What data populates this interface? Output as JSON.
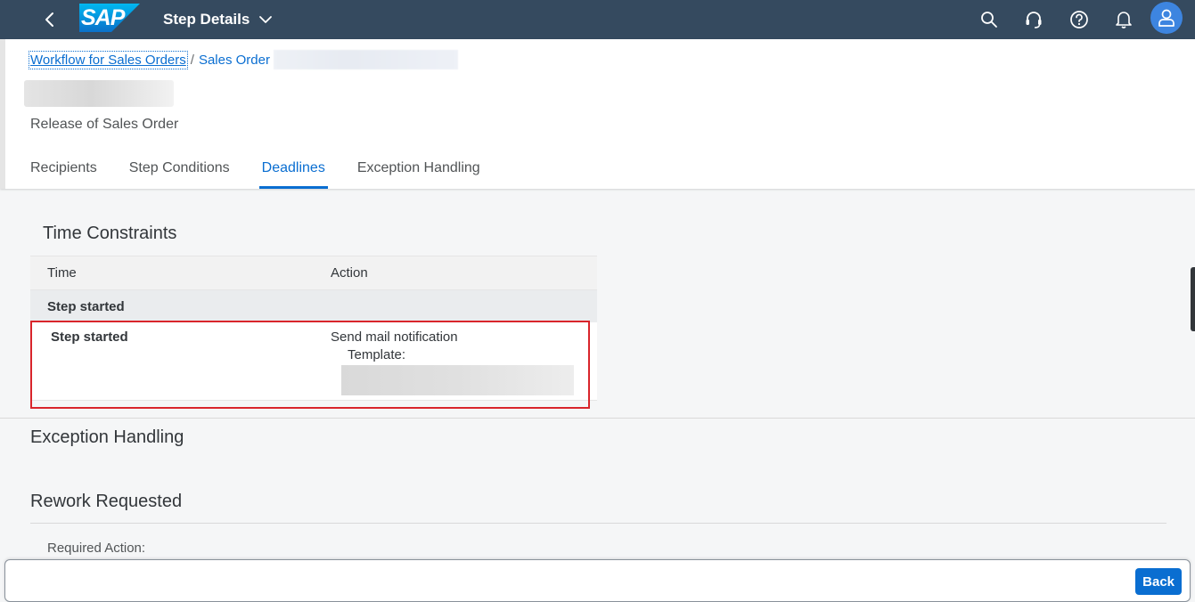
{
  "shell": {
    "title": "Step Details",
    "logo_text": "SAP",
    "colors": {
      "shell_bg": "#354a5f",
      "accent": "#0a6ed1",
      "highlight": "#d9252b"
    }
  },
  "breadcrumb": {
    "items": [
      {
        "label": "Workflow for Sales Orders"
      },
      {
        "label": "Sales Order"
      }
    ],
    "separator": "/"
  },
  "header": {
    "subtitle": "Release of Sales Order"
  },
  "tabs": [
    {
      "label": "Recipients",
      "active": false
    },
    {
      "label": "Step Conditions",
      "active": false
    },
    {
      "label": "Deadlines",
      "active": true
    },
    {
      "label": "Exception Handling",
      "active": false
    }
  ],
  "time_constraints": {
    "title": "Time Constraints",
    "columns": {
      "time": "Time",
      "action": "Action"
    },
    "group_label": "Step started",
    "rows": [
      {
        "time": "Step started",
        "action": "Send mail notification",
        "template_label": "Template:"
      }
    ]
  },
  "exception_handling": {
    "title": "Exception Handling"
  },
  "rework": {
    "title": "Rework Requested",
    "field_label": "Required Action:"
  },
  "footer": {
    "back_label": "Back"
  }
}
